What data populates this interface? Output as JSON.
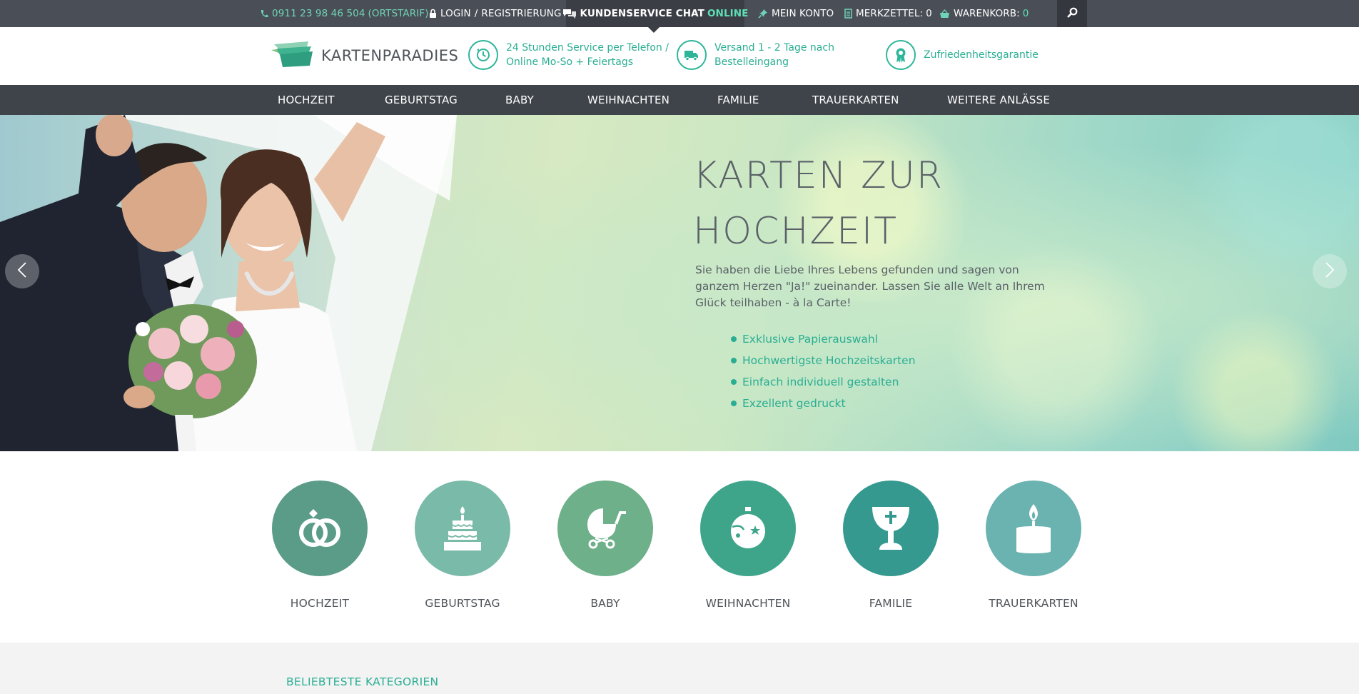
{
  "topbar": {
    "phone": "0911 23 98 46 504",
    "phone_note": "(ORTSTARIF)",
    "login": "LOGIN",
    "register": "REGISTRIERUNG",
    "chat_label": "KUNDENSERVICE CHAT",
    "chat_status": "ONLINE",
    "account": "MEIN KONTO",
    "wishlist_label": "MERKZETTEL:",
    "wishlist_count": "0",
    "cart_label": "WARENKORB:",
    "cart_count": "0"
  },
  "header": {
    "logo_text": "KARTENPARADIES",
    "usps": [
      {
        "line1": "24 Stunden Service per Telefon /",
        "line2": "Online Mo-So + Feiertags",
        "icon": "clock-icon"
      },
      {
        "line1": "Versand 1 - 2 Tage nach",
        "line2": "Bestelleingang",
        "icon": "truck-icon"
      },
      {
        "line1": "Zufriedenheitsgarantie",
        "line2": "",
        "icon": "award-icon"
      }
    ]
  },
  "nav": {
    "items": [
      "HOCHZEIT",
      "GEBURTSTAG",
      "BABY",
      "WEIHNACHTEN",
      "FAMILIE",
      "TRAUERKARTEN",
      "WEITERE ANLÄSSE"
    ]
  },
  "hero": {
    "title_line1": "KARTEN ZUR",
    "title_line2": "HOCHZEIT",
    "text": "Sie haben die Liebe Ihres Lebens gefunden und sagen von ganzem Herzen \"Ja!\" zueinander. Lassen Sie alle Welt an Ihrem Glück teilhaben - à la Carte!",
    "bullets": [
      "Exklusive Papierauswahl",
      "Hochwertigste Hochzeitskarten",
      "Einfach individuell gestalten",
      "Exzellent gedruckt"
    ]
  },
  "categories": [
    {
      "label": "HOCHZEIT",
      "color": "#5b9c88",
      "icon": "rings-icon"
    },
    {
      "label": "GEBURTSTAG",
      "color": "#7abaa8",
      "icon": "cake-icon"
    },
    {
      "label": "BABY",
      "color": "#6db08a",
      "icon": "stroller-icon"
    },
    {
      "label": "WEIHNACHTEN",
      "color": "#3fa58a",
      "icon": "ornament-icon"
    },
    {
      "label": "FAMILIE",
      "color": "#35998f",
      "icon": "chalice-icon"
    },
    {
      "label": "TRAUERKARTEN",
      "color": "#6ab3b0",
      "icon": "candle-icon"
    }
  ],
  "popular": {
    "title": "BELIEBTESTE KATEGORIEN"
  },
  "colors": {
    "accent": "#2aae93",
    "topbar_bg": "#4a4f57",
    "nav_bg": "#3f444a"
  }
}
